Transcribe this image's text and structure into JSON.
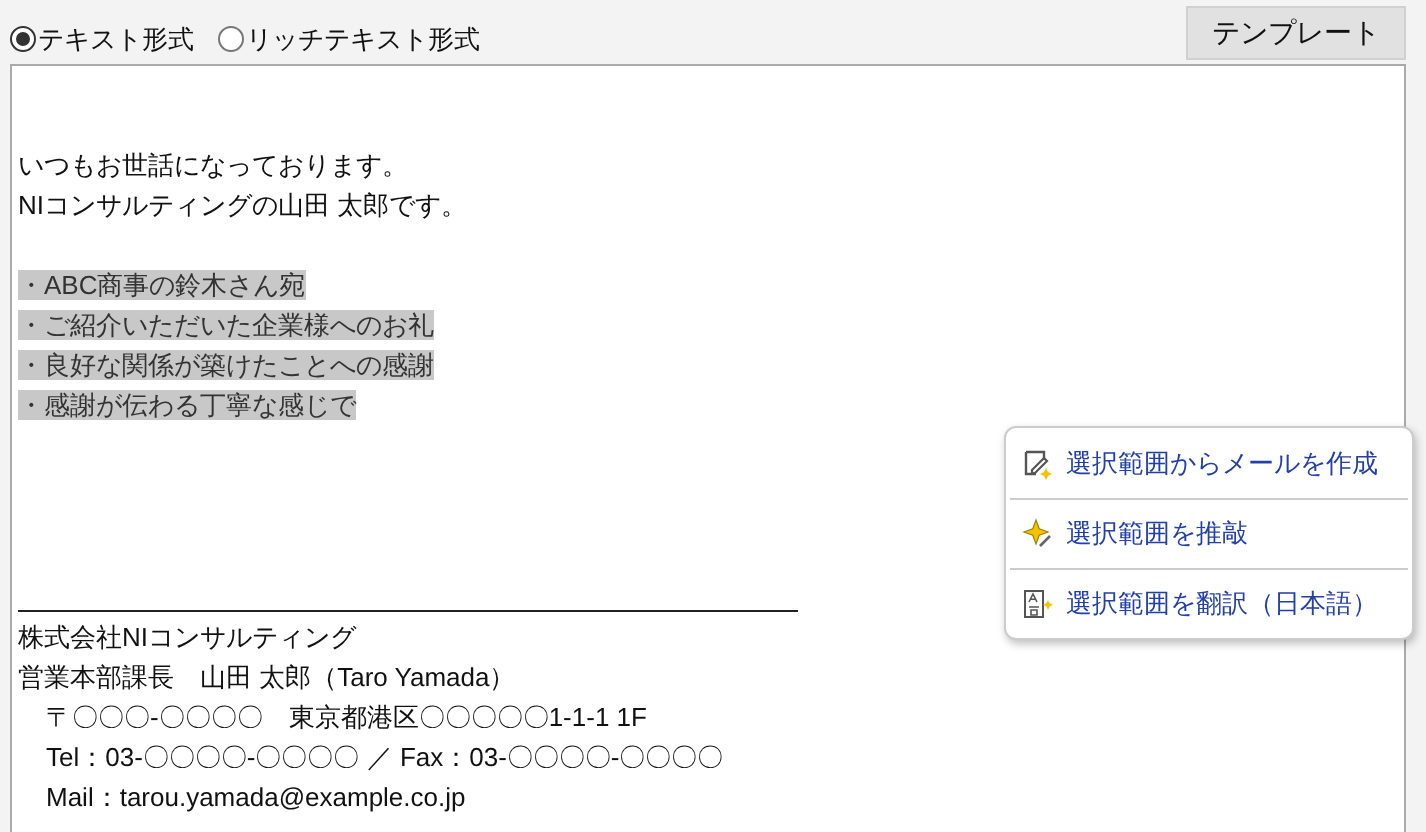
{
  "format_options": [
    {
      "label": "テキスト形式",
      "selected": true
    },
    {
      "label": "リッチテキスト形式",
      "selected": false
    }
  ],
  "template_button": "テンプレート",
  "body": {
    "greeting": [
      {
        "text": "いつもお世話になっております。",
        "selected": false
      },
      {
        "text": "NIコンサルティングの山田 太郎です。",
        "selected": false
      }
    ],
    "notes": [
      {
        "text": "・ABC商事の鈴木さん宛",
        "selected": true
      },
      {
        "text": "・ご紹介いただいた企業様へのお礼",
        "selected": true
      },
      {
        "text": "・良好な関係が築けたことへの感謝",
        "selected": true
      },
      {
        "text": "・感謝が伝わる丁寧な感じで",
        "selected": true
      }
    ],
    "signature": [
      "株式会社NIコンサルティング",
      "営業本部課長　山田 太郎（Taro Yamada）"
    ],
    "contact_lines": [
      "〒〇〇〇-〇〇〇〇　東京都港区〇〇〇〇〇1-1-1 1F",
      "Tel：03-〇〇〇〇-〇〇〇〇 ／ Fax：03-〇〇〇〇-〇〇〇〇",
      "Mail：tarou.yamada@example.co.jp"
    ]
  },
  "context_menu": [
    {
      "kind": "compose",
      "label": "選択範囲からメールを作成"
    },
    {
      "kind": "polish",
      "label": "選択範囲を推敲"
    },
    {
      "kind": "translate",
      "label": "選択範囲を翻訳（日本語）"
    }
  ]
}
